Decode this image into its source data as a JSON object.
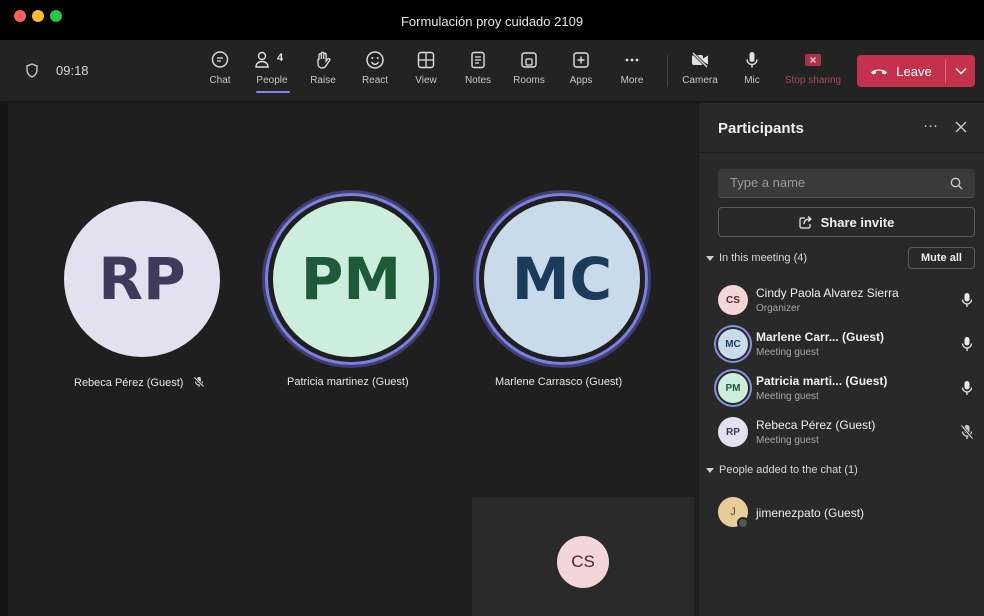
{
  "window": {
    "title": "Formulación proy cuidado 2109"
  },
  "toolbar": {
    "timer": "09:18",
    "people_count": "4",
    "buttons": [
      {
        "label": "Chat",
        "icon": "chat-icon"
      },
      {
        "label": "People",
        "icon": "people-icon",
        "active": true
      },
      {
        "label": "Raise",
        "icon": "raise-hand-icon"
      },
      {
        "label": "React",
        "icon": "react-smiley-icon"
      },
      {
        "label": "View",
        "icon": "view-grid-icon"
      },
      {
        "label": "Notes",
        "icon": "notes-icon"
      },
      {
        "label": "Rooms",
        "icon": "rooms-icon"
      },
      {
        "label": "Apps",
        "icon": "apps-plus-icon"
      },
      {
        "label": "More",
        "icon": "more-dots-icon"
      }
    ],
    "camera_label": "Camera",
    "mic_label": "Mic",
    "stop_sharing_label": "Stop sharing",
    "leave_label": "Leave",
    "accent": "#7f85f5",
    "leave_color": "#c4314b"
  },
  "stage": {
    "tiles": [
      {
        "initials": "RP",
        "name": "Rebeca Pérez (Guest)",
        "muted": true,
        "speaking": false,
        "bg": "#e3e0ef",
        "fg": "#3e3a5a"
      },
      {
        "initials": "PM",
        "name": "Patricia martinez (Guest)",
        "muted": false,
        "speaking": true,
        "bg": "#cdeedd",
        "fg": "#1d5a38"
      },
      {
        "initials": "MC",
        "name": "Marlene Carrasco (Guest)",
        "muted": false,
        "speaking": true,
        "bg": "#c9daea",
        "fg": "#1c3a5a"
      }
    ],
    "self_initials": "CS"
  },
  "panel": {
    "title": "Participants",
    "search_placeholder": "Type a name",
    "share_invite_label": "Share invite",
    "in_meeting_label": "In this meeting (4)",
    "mute_all_label": "Mute all",
    "participants": [
      {
        "initials": "CS",
        "name": "Cindy Paola Alvarez Sierra",
        "role": "Organizer",
        "muted": false,
        "bold": false,
        "ringed": false,
        "bg": "#f2d6d8",
        "fg": "#5a2a33"
      },
      {
        "initials": "MC",
        "name": "Marlene Carr...  (Guest)",
        "role": "Meeting guest",
        "muted": false,
        "bold": true,
        "ringed": true,
        "bg": "#c9daea",
        "fg": "#1c3a5a"
      },
      {
        "initials": "PM",
        "name": "Patricia marti...  (Guest)",
        "role": "Meeting guest",
        "muted": false,
        "bold": true,
        "ringed": true,
        "bg": "#cdeedd",
        "fg": "#1d5a38"
      },
      {
        "initials": "RP",
        "name": "Rebeca Pérez (Guest)",
        "role": "Meeting guest",
        "muted": true,
        "bold": false,
        "ringed": false,
        "bg": "#e3e0ef",
        "fg": "#3e3a5a"
      }
    ],
    "chat_section_label": "People added to the chat (1)",
    "chat_people": [
      {
        "initial": "J",
        "name": "jimenezpato (Guest)"
      }
    ]
  }
}
